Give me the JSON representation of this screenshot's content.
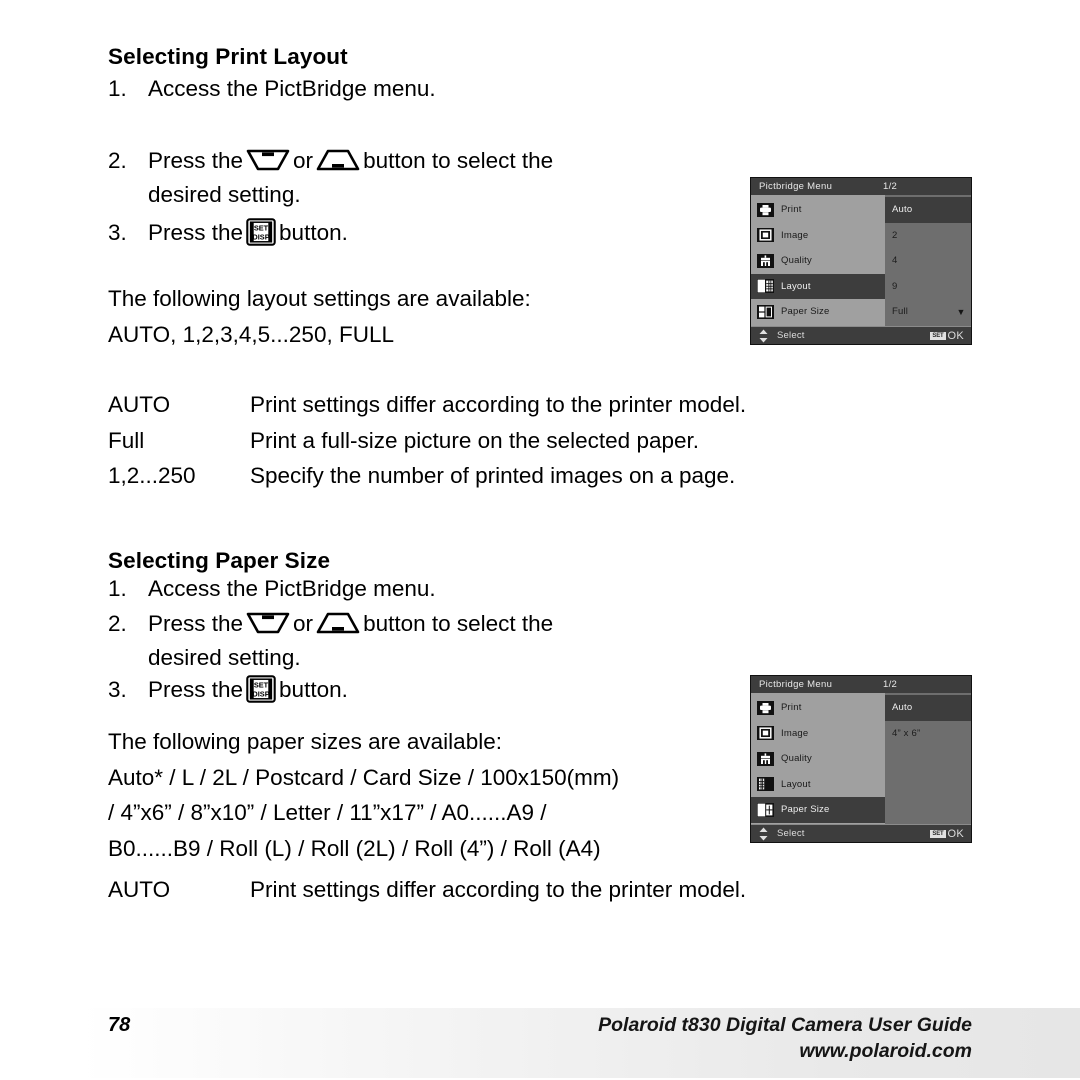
{
  "document": {
    "page_number": "78",
    "footer_title": "Polaroid t830 Digital Camera User Guide",
    "footer_url": "www.polaroid.com"
  },
  "sections": [
    {
      "heading": "Selecting Print Layout",
      "steps": [
        {
          "num": "1.",
          "pre": "Access the PictBridge menu.",
          "post": ""
        },
        {
          "num": "2.",
          "pre": "Press the",
          "mid": "or",
          "post": "button to select the",
          "cont": "desired setting."
        },
        {
          "num": "3.",
          "pre": "Press the",
          "post": "button."
        }
      ],
      "intro": "The following layout settings are available:",
      "values_line": "AUTO, 1,2,3,4,5...250, FULL",
      "definitions": [
        {
          "term": "AUTO",
          "desc": "Print settings differ according to the printer model."
        },
        {
          "term": "Full",
          "desc": "Print a full-size picture on the selected paper."
        },
        {
          "term": "1,2...250",
          "desc": "Specify the number of printed images on a page."
        }
      ]
    },
    {
      "heading": "Selecting Paper Size",
      "steps": [
        {
          "num": "1.",
          "pre": "Access the PictBridge menu.",
          "post": ""
        },
        {
          "num": "2.",
          "pre": "Press the",
          "mid": "or",
          "post": "button to select the",
          "cont": "desired setting."
        },
        {
          "num": "3.",
          "pre": "Press the",
          "post": "button."
        }
      ],
      "intro": "The following paper sizes are available:",
      "values_lines": [
        "Auto* / L / 2L / Postcard / Card Size / 100x150(mm)",
        "/ 4”x6” / 8”x10” / Letter / 11”x17” / A0......A9 /",
        "B0......B9 / Roll (L) / Roll (2L) / Roll (4”) / Roll (A4)"
      ],
      "definitions": [
        {
          "term": "AUTO",
          "desc": "Print settings differ according to the printer model."
        }
      ]
    }
  ],
  "buttons": {
    "down_icon_name": "down-trapezoid-button-icon",
    "up_icon_name": "up-trapezoid-button-icon",
    "setdisp_top": "SET",
    "setdisp_bottom": "DISP"
  },
  "lcd_screens": [
    {
      "id": "layout-menu",
      "title": "Pictbridge Menu",
      "page_indicator": "1/2",
      "menu_items": [
        {
          "label": "Print",
          "icon": "printer-icon",
          "selected": false
        },
        {
          "label": "Image",
          "icon": "image-icon",
          "selected": false
        },
        {
          "label": "Quality",
          "icon": "quality-icon",
          "selected": false
        },
        {
          "label": "Layout",
          "icon": "layout-icon",
          "selected": true
        },
        {
          "label": "Paper Size",
          "icon": "paper-size-icon",
          "selected": false
        }
      ],
      "values": [
        {
          "text": "Auto",
          "selected": true,
          "arrow": ""
        },
        {
          "text": "2",
          "selected": false,
          "arrow": ""
        },
        {
          "text": "4",
          "selected": false,
          "arrow": ""
        },
        {
          "text": "9",
          "selected": false,
          "arrow": ""
        },
        {
          "text": "Full",
          "selected": false,
          "arrow": "▼"
        }
      ],
      "footer_label": "Select",
      "footer_set_badge": "SET",
      "footer_ok": "OK"
    },
    {
      "id": "paper-size-menu",
      "title": "Pictbridge Menu",
      "page_indicator": "1/2",
      "menu_items": [
        {
          "label": "Print",
          "icon": "printer-icon",
          "selected": false
        },
        {
          "label": "Image",
          "icon": "image-icon",
          "selected": false
        },
        {
          "label": "Quality",
          "icon": "quality-icon",
          "selected": false
        },
        {
          "label": "Layout",
          "icon": "layout-icon",
          "selected": false
        },
        {
          "label": "Paper Size",
          "icon": "paper-size-icon",
          "selected": true
        }
      ],
      "values": [
        {
          "text": "Auto",
          "selected": true,
          "arrow": ""
        },
        {
          "text": "4” x 6”",
          "selected": false,
          "arrow": ""
        },
        {
          "text": "",
          "selected": false,
          "arrow": ""
        },
        {
          "text": "",
          "selected": false,
          "arrow": ""
        },
        {
          "text": "",
          "selected": false,
          "arrow": ""
        }
      ],
      "footer_label": "Select",
      "footer_set_badge": "SET",
      "footer_ok": "OK"
    }
  ],
  "colors": {
    "lcd_panel": "#a0a0a0",
    "lcd_values_panel": "#6e6e6e",
    "lcd_chrome": "#3d3d3d",
    "page_bg": "#ffffff"
  }
}
